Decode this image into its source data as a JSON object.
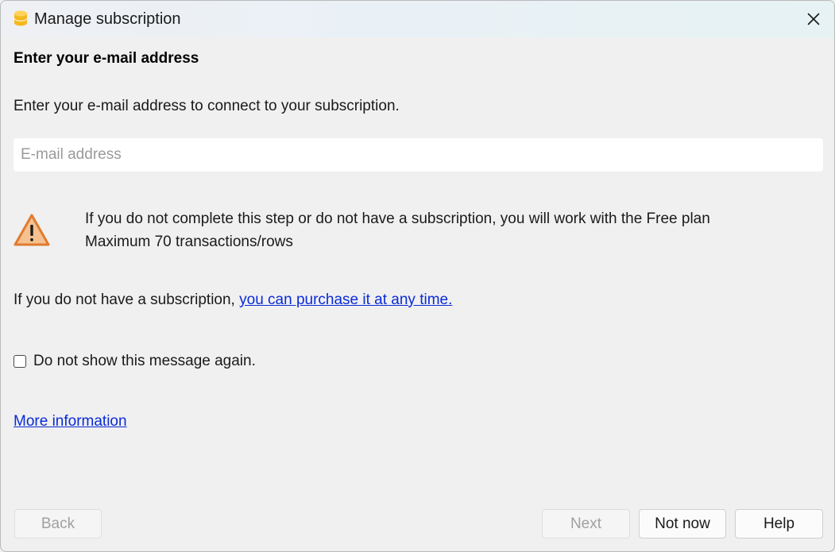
{
  "window": {
    "title": "Manage subscription",
    "icon": "app-coin-stack-icon",
    "close_icon": "close-icon"
  },
  "content": {
    "heading": "Enter your e-mail address",
    "description": "Enter your e-mail address to connect to your subscription.",
    "email": {
      "value": "",
      "placeholder": "E-mail address"
    },
    "warning": {
      "icon": "warning-triangle-icon",
      "line1": "If you do not complete this step or do not have a subscription, you will work with the Free plan",
      "line2": "Maximum 70 transactions/rows"
    },
    "purchase": {
      "prefix": "If you do not have a subscription, ",
      "link_text": "you can purchase it at any time."
    },
    "checkbox": {
      "label": "Do not show this message again.",
      "checked": false
    },
    "more_info_link": "More information"
  },
  "buttons": {
    "back": "Back",
    "next": "Next",
    "not_now": "Not now",
    "help": "Help"
  },
  "colors": {
    "link": "#0a2bd6",
    "warning_fill": "#f5c18f",
    "warning_stroke": "#e07b30",
    "app_icon": "#f5b81c"
  }
}
